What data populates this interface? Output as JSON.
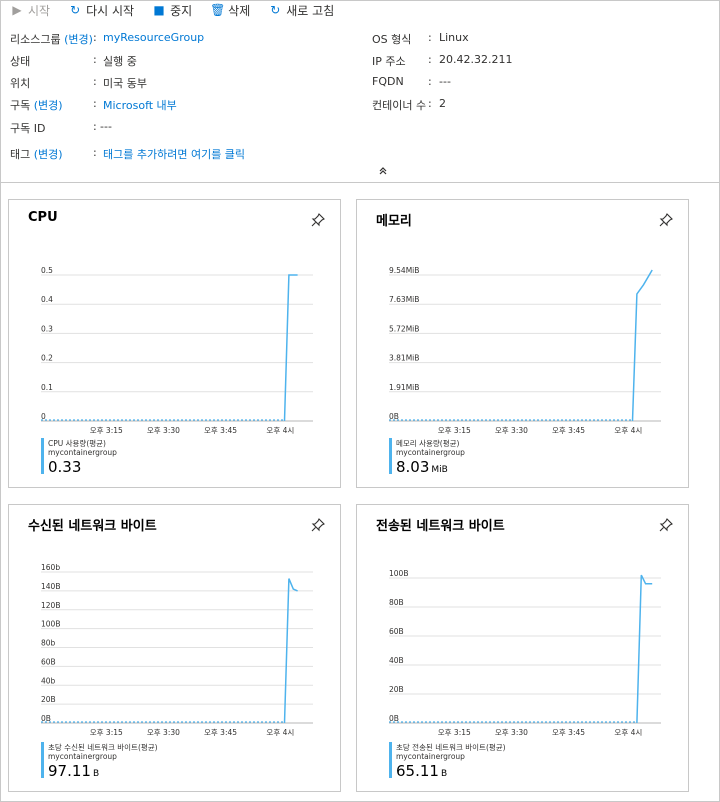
{
  "toolbar": {
    "start": "시작",
    "restart": "다시 시작",
    "stop": "중지",
    "delete": "삭제",
    "refresh": "새로 고침"
  },
  "essentials": {
    "left": [
      {
        "key": "리소스그룹",
        "change": "(변경)",
        "value": "myResourceGroup",
        "link": true
      },
      {
        "key": "상태",
        "change": "",
        "value": "실행 중",
        "link": false
      },
      {
        "key": "위치",
        "change": "",
        "value": "미국 동부",
        "link": false
      },
      {
        "key": "구독",
        "change": "(변경)",
        "value": "Microsoft 내부",
        "link": true
      },
      {
        "key": "구독 ID",
        "change": "",
        "value": "---",
        "link": false
      },
      {
        "key": "태그",
        "change": "(변경)",
        "value": "태그를 추가하려면 여기를 클릭",
        "link": true
      }
    ],
    "right": [
      {
        "key": "OS 형식",
        "value": "Linux"
      },
      {
        "key": "IP 주소",
        "value": "20.42.32.211"
      },
      {
        "key": "FQDN",
        "value": "---"
      },
      {
        "key": "컨테이너 수",
        "value": "2"
      }
    ],
    "colon": ":",
    "collapse_icon": "double-chevron-up-icon"
  },
  "colors": {
    "series": "#4eb3ed",
    "link": "#0078d4",
    "grid": "#e1e1e1",
    "baseline": "#b7b7b7"
  },
  "tiles": [
    {
      "title": "CPU",
      "legend_name": "CPU 사용량(평균)",
      "legend_sub": "mycontainergroup",
      "legend_value": "0.33",
      "legend_unit": "",
      "chart_data": {
        "type": "line",
        "x_ticks": [
          "오후 3:15",
          "오후 3:30",
          "오후 3:45",
          "오후 4시"
        ],
        "y_ticks": [
          "0.5",
          "0.4",
          "0.3",
          "0.2",
          "0.1",
          "0"
        ],
        "ylim": [
          0,
          0.5
        ],
        "xlim": [
          0,
          62
        ],
        "series": [
          {
            "x": [
              0,
              55.5,
              56.5,
              58.5
            ],
            "y": [
              0,
              0,
              0.5,
              0.5
            ]
          }
        ]
      }
    },
    {
      "title": "메모리",
      "legend_name": "메모리 사용량(평균)",
      "legend_sub": "mycontainergroup",
      "legend_value": "8.03",
      "legend_unit": "MiB",
      "chart_data": {
        "type": "line",
        "x_ticks": [
          "오후 3:15",
          "오후 3:30",
          "오후 3:45",
          "오후 4시"
        ],
        "y_ticks": [
          "9.54MiB",
          "7.63MiB",
          "5.72MiB",
          "3.81MiB",
          "1.91MiB",
          "0B"
        ],
        "ylim": [
          0,
          9.54
        ],
        "xlim": [
          0,
          62
        ],
        "series": [
          {
            "x": [
              0,
              55.5,
              56.5,
              58,
              60
            ],
            "y": [
              0,
              0,
              8.3,
              8.9,
              9.9
            ]
          }
        ]
      }
    },
    {
      "title": "수신된 네트워크 바이트",
      "legend_name": "초당 수신된 네트워크 바이트(평균)",
      "legend_sub": "mycontainergroup",
      "legend_value": "97.11",
      "legend_unit": "B",
      "chart_data": {
        "type": "line",
        "x_ticks": [
          "오후 3:15",
          "오후 3:30",
          "오후 3:45",
          "오후 4시"
        ],
        "y_ticks": [
          "160b",
          "140B",
          "120B",
          "100B",
          "80b",
          "60B",
          "40b",
          "20B",
          "0B"
        ],
        "ylim": [
          0,
          160
        ],
        "xlim": [
          0,
          62
        ],
        "series": [
          {
            "x": [
              0,
              55.5,
              56.5,
              57.5,
              58.5
            ],
            "y": [
              0,
              0,
              153,
              142,
              140
            ]
          }
        ]
      }
    },
    {
      "title": "전송된 네트워크 바이트",
      "legend_name": "초당 전송된 네트워크 바이트(평균)",
      "legend_sub": "mycontainergroup",
      "legend_value": "65.11",
      "legend_unit": "B",
      "chart_data": {
        "type": "line",
        "x_ticks": [
          "오후 3:15",
          "오후 3:30",
          "오후 3:45",
          "오후 4시"
        ],
        "y_ticks": [
          "100B",
          "80B",
          "60B",
          "40B",
          "20B",
          "0B"
        ],
        "ylim": [
          0,
          100
        ],
        "xlim": [
          0,
          62
        ],
        "series": [
          {
            "x": [
              0,
              56.5,
              57.5,
              58.5,
              60
            ],
            "y": [
              0,
              0,
              102,
              96,
              96
            ]
          }
        ]
      }
    }
  ]
}
